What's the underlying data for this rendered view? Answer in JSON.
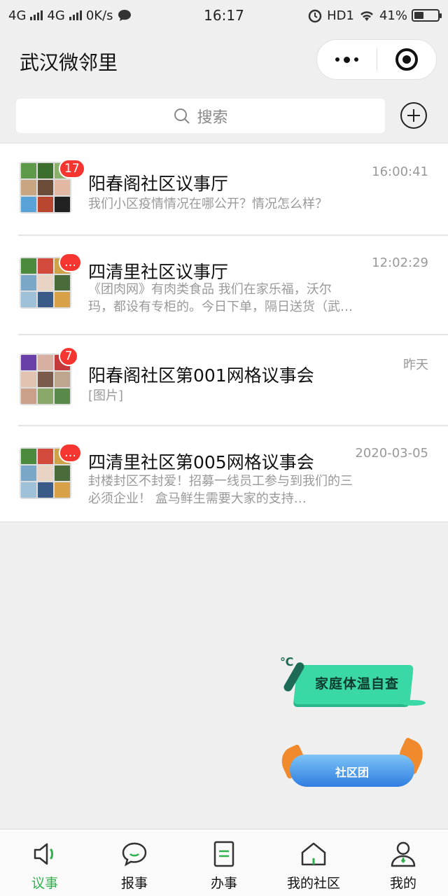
{
  "status_bar": {
    "network1": "4G",
    "network2": "4G",
    "speed": "0K/s",
    "time": "16:17",
    "hd": "HD1",
    "battery": "41%",
    "battery_level": 0.41
  },
  "header": {
    "title": "武汉微邻里"
  },
  "search": {
    "placeholder": "搜索"
  },
  "chats": [
    {
      "title": "阳春阁社区议事厅",
      "time": "16:00:41",
      "badge": "17",
      "preview": "我们小区疫情情况在哪公开？情况怎么样？"
    },
    {
      "title": "四清里社区议事厅",
      "time": "12:02:29",
      "badge": "…",
      "preview": "《团肉网》有肉类食品 我们在家乐福，沃尔玛，都设有专柜的。今日下单，隔日送货（武…"
    },
    {
      "title": "阳春阁社区第001网格议事会",
      "time": "昨天",
      "badge": "7",
      "preview": "[图片]"
    },
    {
      "title": "四清里社区第005网格议事会",
      "time": "2020-03-05",
      "badge": "…",
      "preview": "封楼封区不封爱！招募一线员工参与到我们的三必须企业！ 盒马鲜生需要大家的支持…"
    }
  ],
  "floating": {
    "temp_check": "家庭体温自查",
    "temp_unit": "℃",
    "community_group": "社区团"
  },
  "tabs": [
    {
      "label": "议事",
      "icon": "speaker-icon"
    },
    {
      "label": "报事",
      "icon": "chat-bubble-icon"
    },
    {
      "label": "办事",
      "icon": "document-icon"
    },
    {
      "label": "我的社区",
      "icon": "home-icon"
    },
    {
      "label": "我的",
      "icon": "person-icon"
    }
  ],
  "colors": {
    "accent": "#2fb24c",
    "badge": "#f43530",
    "temp_card": "#3ad8a7",
    "community_wave": "#2f7de1"
  }
}
